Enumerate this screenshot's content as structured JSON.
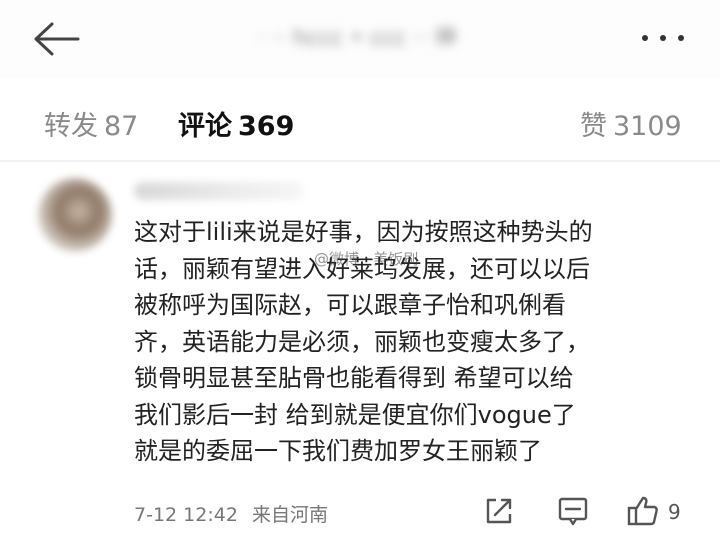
{
  "header": {
    "back_icon": "arrow-left-icon",
    "title": "· ·· hccc • ccc ·· 神",
    "more_icon": "more-dots-icon"
  },
  "tabs": [
    {
      "label": "转发",
      "count": "87",
      "active": false
    },
    {
      "label": "评论",
      "count": "369",
      "active": true
    },
    {
      "label": "赞",
      "count": "3109",
      "active": false
    }
  ],
  "comment": {
    "lines": [
      "这对于lili来说是好事，因为按照这种势头的",
      "话，丽颖有望进入好莱坞发展，还可以以后",
      "被称呼为国际赵，可以跟章子怡和巩俐看",
      "齐，英语能力是必须，丽颖也变瘦太多了，",
      "锁骨明显甚至胋骨也能看得到 希望可以给",
      "我们影后一封 给到就是便宜你们vogue了",
      "就是的委屈一下我们费加罗女王丽颖了"
    ],
    "timestamp": "7-12 12:42",
    "location": "来自河南",
    "like_count": "9",
    "icons": [
      "share-icon",
      "reply-icon",
      "thumbs-up-icon"
    ]
  },
  "watermark": "@微博 · 美饭刷"
}
